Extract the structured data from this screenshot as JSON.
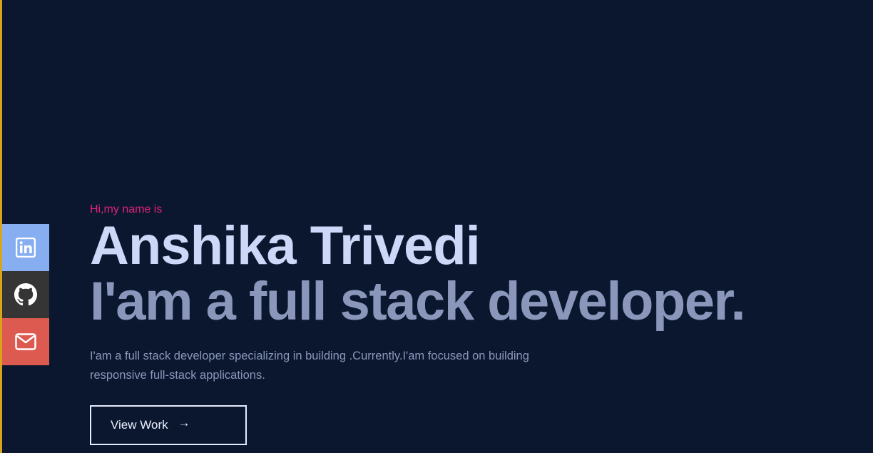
{
  "colors": {
    "background": "#0b172e",
    "accent_bar": "#d8a51a",
    "greeting": "#e0237a",
    "name": "#cdd7f8",
    "tagline": "#8a97bb",
    "linkedin": "#86aef0",
    "github": "#353535",
    "mail": "#dc5a50"
  },
  "social": [
    {
      "name": "LinkedIn",
      "icon": "linkedin-icon"
    },
    {
      "name": "GitHub",
      "icon": "github-icon"
    },
    {
      "name": "Email",
      "icon": "mail-icon"
    }
  ],
  "hero": {
    "greeting": "Hi,my name is",
    "name": "Anshika Trivedi",
    "tagline": "I'am a full stack developer.",
    "description": "I'am a full stack developer specializing in building .Currently.I'am focused on building responsive full-stack applications.",
    "cta_label": "View Work",
    "cta_arrow": "→"
  }
}
